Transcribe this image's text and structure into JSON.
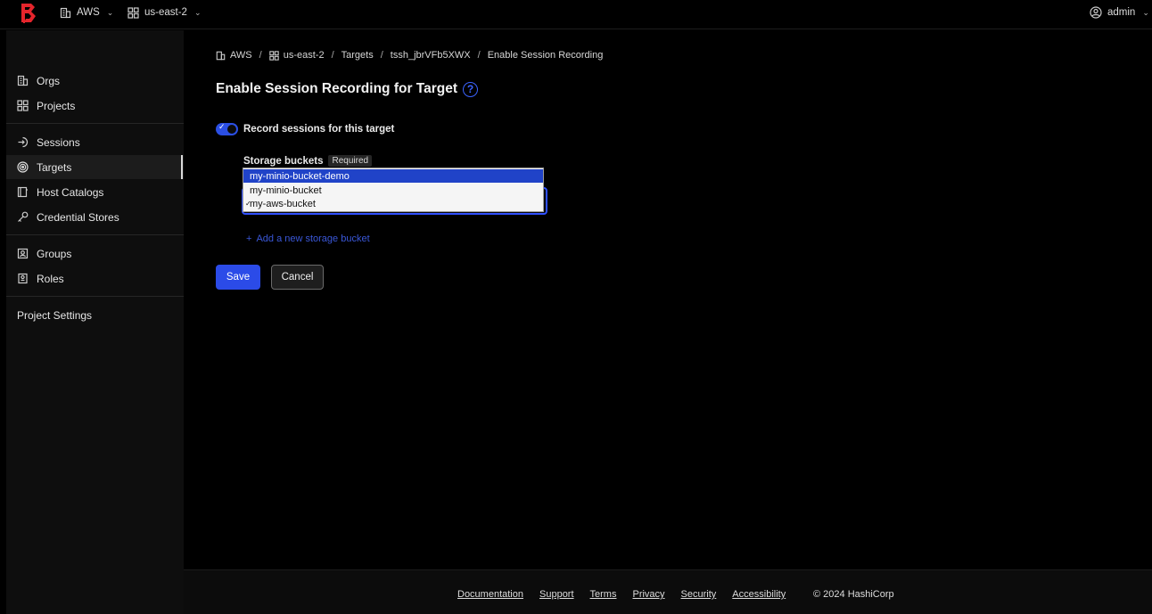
{
  "topbar": {
    "org": "AWS",
    "project": "us-east-2",
    "user": "admin"
  },
  "sidebar": {
    "items": [
      {
        "label": "Orgs"
      },
      {
        "label": "Projects"
      },
      {
        "label": "Sessions"
      },
      {
        "label": "Targets"
      },
      {
        "label": "Host Catalogs"
      },
      {
        "label": "Credential Stores"
      },
      {
        "label": "Groups"
      },
      {
        "label": "Roles"
      },
      {
        "label": "Project Settings"
      }
    ],
    "active": "Targets"
  },
  "breadcrumb": {
    "items": [
      "AWS",
      "us-east-2",
      "Targets",
      "tssh_jbrVFb5XWX",
      "Enable Session Recording"
    ],
    "separator": "/"
  },
  "page": {
    "title": "Enable Session Recording for Target",
    "help_icon": "?"
  },
  "form": {
    "toggle_label": "Record sessions for this target",
    "toggle_on": true,
    "storage_label": "Storage buckets",
    "required_badge": "Required",
    "options": [
      "my-minio-bucket-demo",
      "my-minio-bucket",
      "my-aws-bucket"
    ],
    "highlighted_option": "my-minio-bucket-demo",
    "checked_option": "my-aws-bucket",
    "add_link": "Add a new storage bucket",
    "save": "Save",
    "cancel": "Cancel"
  },
  "footer": {
    "links": [
      "Documentation",
      "Support",
      "Terms",
      "Privacy",
      "Security",
      "Accessibility"
    ],
    "copyright": "© 2024 HashiCorp"
  },
  "colors": {
    "accent": "#2b4be8",
    "logo": "#e5252c",
    "background": "#000000",
    "sidebar": "#0e0e0e"
  }
}
